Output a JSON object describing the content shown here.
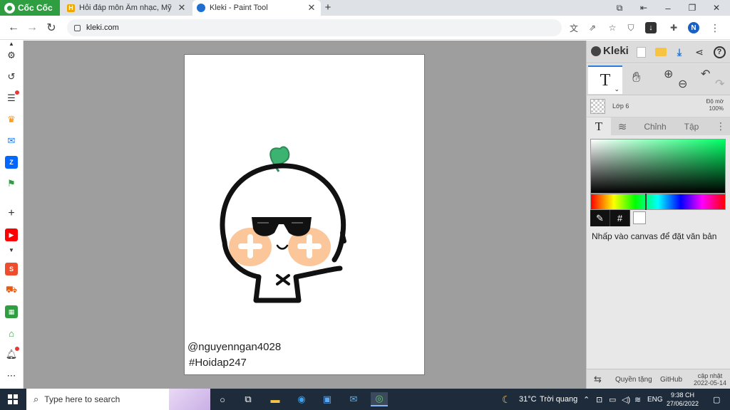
{
  "browser": {
    "brand": "Cốc Cốc",
    "tabs": [
      {
        "title": "Hỏi đáp môn Âm nhạc, Mỹ thuật"
      },
      {
        "title": "Kleki - Paint Tool"
      }
    ],
    "new_tab": "+",
    "url": "kleki.com",
    "avatar_initial": "N"
  },
  "canvas": {
    "text_line_1": "@nguyenngan4028",
    "text_line_2": "#Hoidap247"
  },
  "panel": {
    "logo": "Kleki",
    "tool_text_glyph": "T",
    "layer_name": "Lớp 6",
    "opacity_label": "Độ mờ",
    "opacity_value": "100%",
    "tabs": {
      "text_glyph": "T",
      "edit": "Chỉnh",
      "file": "Tập"
    },
    "hex_button": "#",
    "hint": "Nhấp vào canvas để đặt văn bản",
    "footer": {
      "credits": "Quyền tặng",
      "github": "GitHub",
      "update_label": "cập nhật",
      "update_date": "2022-05-14"
    },
    "colors": {
      "accent": "#2f7bd6",
      "current": "#ffffff"
    }
  },
  "taskbar": {
    "search_placeholder": "Type here to search",
    "weather_temp": "31°C",
    "weather_desc": "Trời quang",
    "language": "ENG",
    "time": "9:38 CH",
    "date": "27/06/2022"
  }
}
